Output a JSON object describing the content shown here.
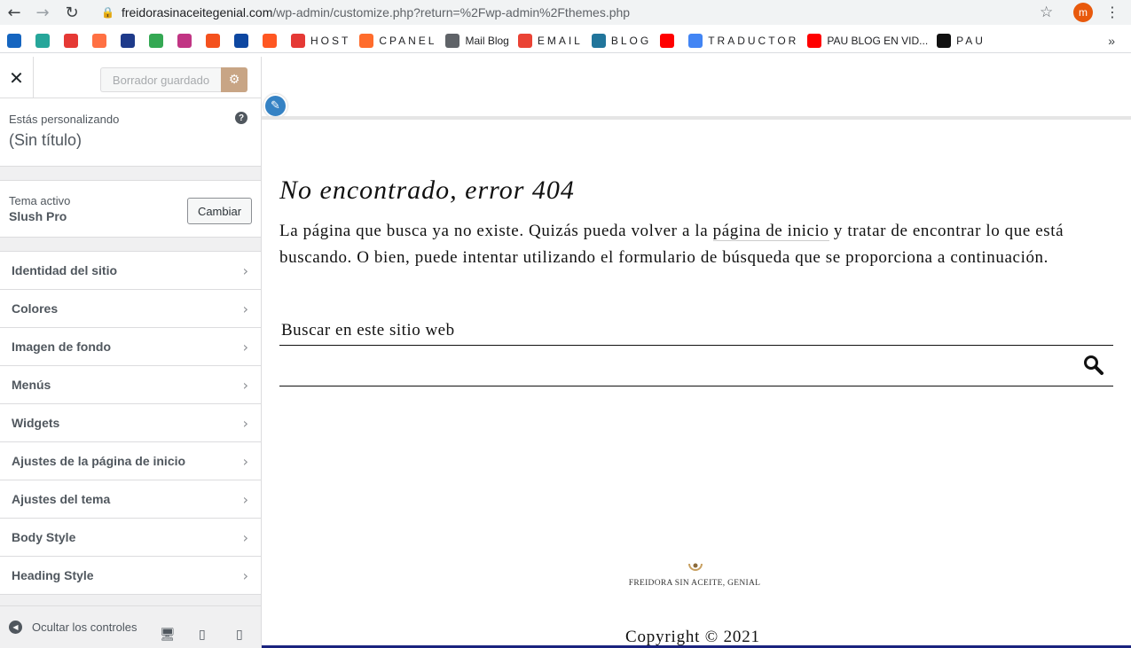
{
  "browser": {
    "url_host": "freidorasinaceitegenial.com",
    "url_path": "/wp-admin/customize.php?return=%2Fwp-admin%2Fthemes.php",
    "avatar_letter": "m",
    "bookmarks": [
      {
        "label": "",
        "color": "#1565c0"
      },
      {
        "label": "",
        "color": "#26a69a"
      },
      {
        "label": "",
        "color": "#e53935"
      },
      {
        "label": "",
        "color": "#ff7043"
      },
      {
        "label": "",
        "color": "#1e3a8a"
      },
      {
        "label": "",
        "color": "#34a853"
      },
      {
        "label": "",
        "color": "#c13584"
      },
      {
        "label": "",
        "color": "#f4511e"
      },
      {
        "label": "",
        "color": "#0d47a1"
      },
      {
        "label": "",
        "color": "#ff5722"
      },
      {
        "label": "HOST",
        "color": "#e53935",
        "spaced": true
      },
      {
        "label": "CPANEL",
        "color": "#ff6c2c",
        "spaced": true
      },
      {
        "label": "Mail Blog",
        "color": "#5f6368",
        "spaced": false
      },
      {
        "label": "EMAIL",
        "color": "#ea4335",
        "spaced": true
      },
      {
        "label": "BLOG",
        "color": "#21759b",
        "spaced": true
      },
      {
        "label": "",
        "color": "#ff0000"
      },
      {
        "label": "TRADUCTOR",
        "color": "#4285f4",
        "spaced": true
      },
      {
        "label": "PAU BLOG EN VID...",
        "color": "#ff0000",
        "spaced": false
      },
      {
        "label": "PAU",
        "color": "#111111",
        "spaced": true
      }
    ],
    "more": "»"
  },
  "sidebar": {
    "close": "✕",
    "draft_label": "Borrador guardado",
    "info_small": "Estás personalizando",
    "info_title": "(Sin título)",
    "help": "?",
    "theme_label": "Tema activo",
    "theme_name": "Slush Pro",
    "change_label": "Cambiar",
    "menu": [
      {
        "label": "Identidad del sitio"
      },
      {
        "label": "Colores"
      },
      {
        "label": "Imagen de fondo"
      },
      {
        "label": "Menús"
      },
      {
        "label": "Widgets"
      },
      {
        "label": "Ajustes de la página de inicio"
      },
      {
        "label": "Ajustes del tema"
      },
      {
        "label": "Body Style"
      },
      {
        "label": "Heading Style"
      }
    ],
    "hide_label": "Ocultar los controles"
  },
  "preview": {
    "title": "No encontrado, error 404",
    "text_before": "La página que busca ya no existe. Quizás pueda volver a la ",
    "text_link": "página de inicio",
    "text_after": " y tratar de encontrar lo que está buscando. O bien, puede intentar utilizando el formulario de búsqueda que se proporciona a continuación.",
    "search_label": "Buscar en este sitio web",
    "logo_text": "FREIDORA SIN ACEITE, GENIAL",
    "copyright": "Copyright © 2021"
  }
}
